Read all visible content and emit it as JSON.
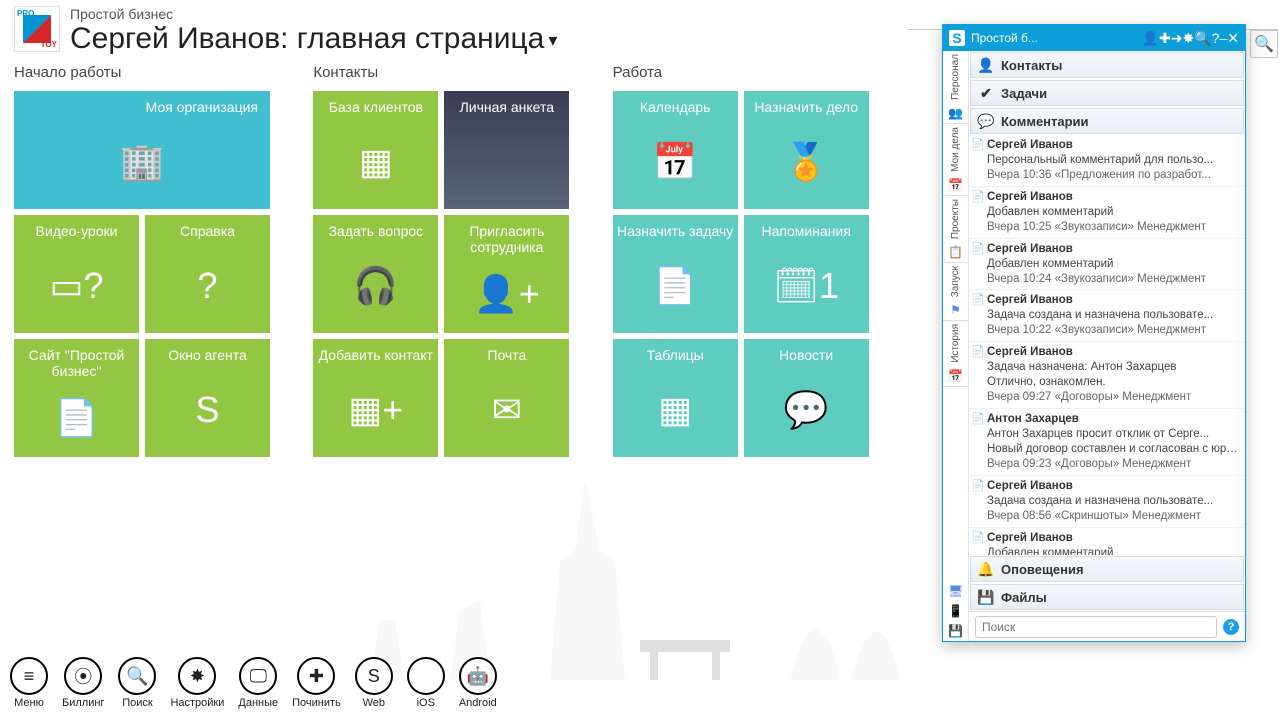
{
  "header": {
    "app_name": "Простой бизнес",
    "page_title": "Сергей Иванов: главная страница"
  },
  "columns": [
    {
      "title": "Начало работы",
      "tiles": [
        {
          "label": "Моя организация",
          "size": "wide",
          "color": "c-blue",
          "icon": "🏢",
          "name": "tile-my-org"
        },
        {
          "label": "Видео-уроки",
          "size": "sm",
          "color": "c-green",
          "icon": "▭?",
          "name": "tile-video-lessons"
        },
        {
          "label": "Справка",
          "size": "sm",
          "color": "c-green",
          "icon": "?",
          "name": "tile-help"
        },
        {
          "label": "Сайт \"Простой бизнес\"",
          "size": "sm",
          "color": "c-green",
          "icon": "📄",
          "name": "tile-site"
        },
        {
          "label": "Окно агента",
          "size": "sm",
          "color": "c-green",
          "icon": "S",
          "name": "tile-agent"
        }
      ]
    },
    {
      "title": "Контакты",
      "tiles": [
        {
          "label": "База клиентов",
          "size": "sm",
          "color": "c-green",
          "icon": "▦",
          "name": "tile-clients"
        },
        {
          "label": "Личная анкета",
          "size": "sm",
          "color": "c-photo",
          "icon": "",
          "name": "tile-profile"
        },
        {
          "label": "Задать вопрос",
          "size": "sm",
          "color": "c-green",
          "icon": "🎧",
          "name": "tile-ask"
        },
        {
          "label": "Пригласить сотрудника",
          "size": "sm",
          "color": "c-green",
          "icon": "👤+",
          "name": "tile-invite"
        },
        {
          "label": "Добавить контакт",
          "size": "sm",
          "color": "c-green",
          "icon": "▦+",
          "name": "tile-add-contact"
        },
        {
          "label": "Почта",
          "size": "sm",
          "color": "c-green",
          "icon": "✉",
          "name": "tile-mail"
        }
      ]
    },
    {
      "title": "Работа",
      "tiles": [
        {
          "label": "Календарь",
          "size": "sm",
          "color": "c-turq",
          "icon": "📅",
          "name": "tile-calendar"
        },
        {
          "label": "Назначить дело",
          "size": "sm",
          "color": "c-turq",
          "icon": "🏅",
          "name": "tile-assign-deal"
        },
        {
          "label": "Назначить задачу",
          "size": "sm",
          "color": "c-turq",
          "icon": "📄",
          "name": "tile-assign-task"
        },
        {
          "label": "Напоминания",
          "size": "sm",
          "color": "c-turq",
          "icon": "🗓1",
          "name": "tile-reminders"
        },
        {
          "label": "Таблицы",
          "size": "sm",
          "color": "c-turq",
          "icon": "▦",
          "name": "tile-tables"
        },
        {
          "label": "Новости",
          "size": "sm",
          "color": "c-turq",
          "icon": "💬",
          "name": "tile-news"
        }
      ]
    }
  ],
  "toolbar": [
    {
      "label": "Меню",
      "icon": "≡",
      "name": "tool-menu"
    },
    {
      "label": "Биллинг",
      "icon": "⦿",
      "name": "tool-billing"
    },
    {
      "label": "Поиск",
      "icon": "🔍",
      "name": "tool-search"
    },
    {
      "label": "Настройки",
      "icon": "✸",
      "name": "tool-settings"
    },
    {
      "label": "Данные",
      "icon": "🖵",
      "name": "tool-data"
    },
    {
      "label": "Починить",
      "icon": "✚",
      "name": "tool-repair"
    },
    {
      "label": "Web",
      "icon": "S",
      "name": "tool-web"
    },
    {
      "label": "iOS",
      "icon": "",
      "name": "tool-ios"
    },
    {
      "label": "Android",
      "icon": "🤖",
      "name": "tool-android"
    }
  ],
  "panel": {
    "title": "Простой б...",
    "title_icons": [
      "👤",
      "✚",
      "➜",
      "✸",
      "🔍",
      "?",
      "–",
      "✕"
    ],
    "rail": [
      {
        "text": "Персонал",
        "icon": "👥"
      },
      {
        "text": "Мои дела",
        "icon": "📅"
      },
      {
        "text": "Проекты",
        "icon": "📋"
      },
      {
        "text": "Запуск",
        "icon": "⚑"
      },
      {
        "text": "История",
        "icon": "📅"
      }
    ],
    "rail_bottom_icons": [
      "🖥",
      "📱",
      "💾"
    ],
    "sections": {
      "contacts": "Контакты",
      "tasks": "Задачи",
      "comments": "Комментарии",
      "alerts": "Оповещения",
      "files": "Файлы"
    },
    "feed": [
      {
        "name": "Сергей Иванов",
        "text": "Персональный комментарий для пользо...",
        "time": "Вчера 10:36 «Предложения по разработ..."
      },
      {
        "name": "Сергей Иванов",
        "text": "Добавлен комментарий",
        "time": "Вчера 10:25 «Звукозаписи» Менеджмент"
      },
      {
        "name": "Сергей Иванов",
        "text": "Добавлен комментарий",
        "time": "Вчера 10:24 «Звукозаписи» Менеджмент"
      },
      {
        "name": "Сергей Иванов",
        "text": "Задача создана и назначена пользовате...",
        "time": "Вчера 10:22 «Звукозаписи» Менеджмент"
      },
      {
        "name": "Сергей Иванов",
        "text": "Задача назначена: Антон Захарцев\nОтлично, ознакомлен.",
        "time": "Вчера 09:27 «Договоры» Менеджмент"
      },
      {
        "name": "Антон Захарцев",
        "text": "Антон Захарцев просит отклик от Серге...\nНовый договор составлен и согласован с юристами.",
        "time": "Вчера 09:23 «Договоры» Менеджмент"
      },
      {
        "name": "Сергей Иванов",
        "text": "Задача создана и назначена пользовате...",
        "time": "Вчера 08:56 «Скриншоты» Менеджмент"
      },
      {
        "name": "Сергей Иванов",
        "text": "Добавлен комментарий",
        "time": ""
      }
    ],
    "search_placeholder": "Поиск"
  }
}
